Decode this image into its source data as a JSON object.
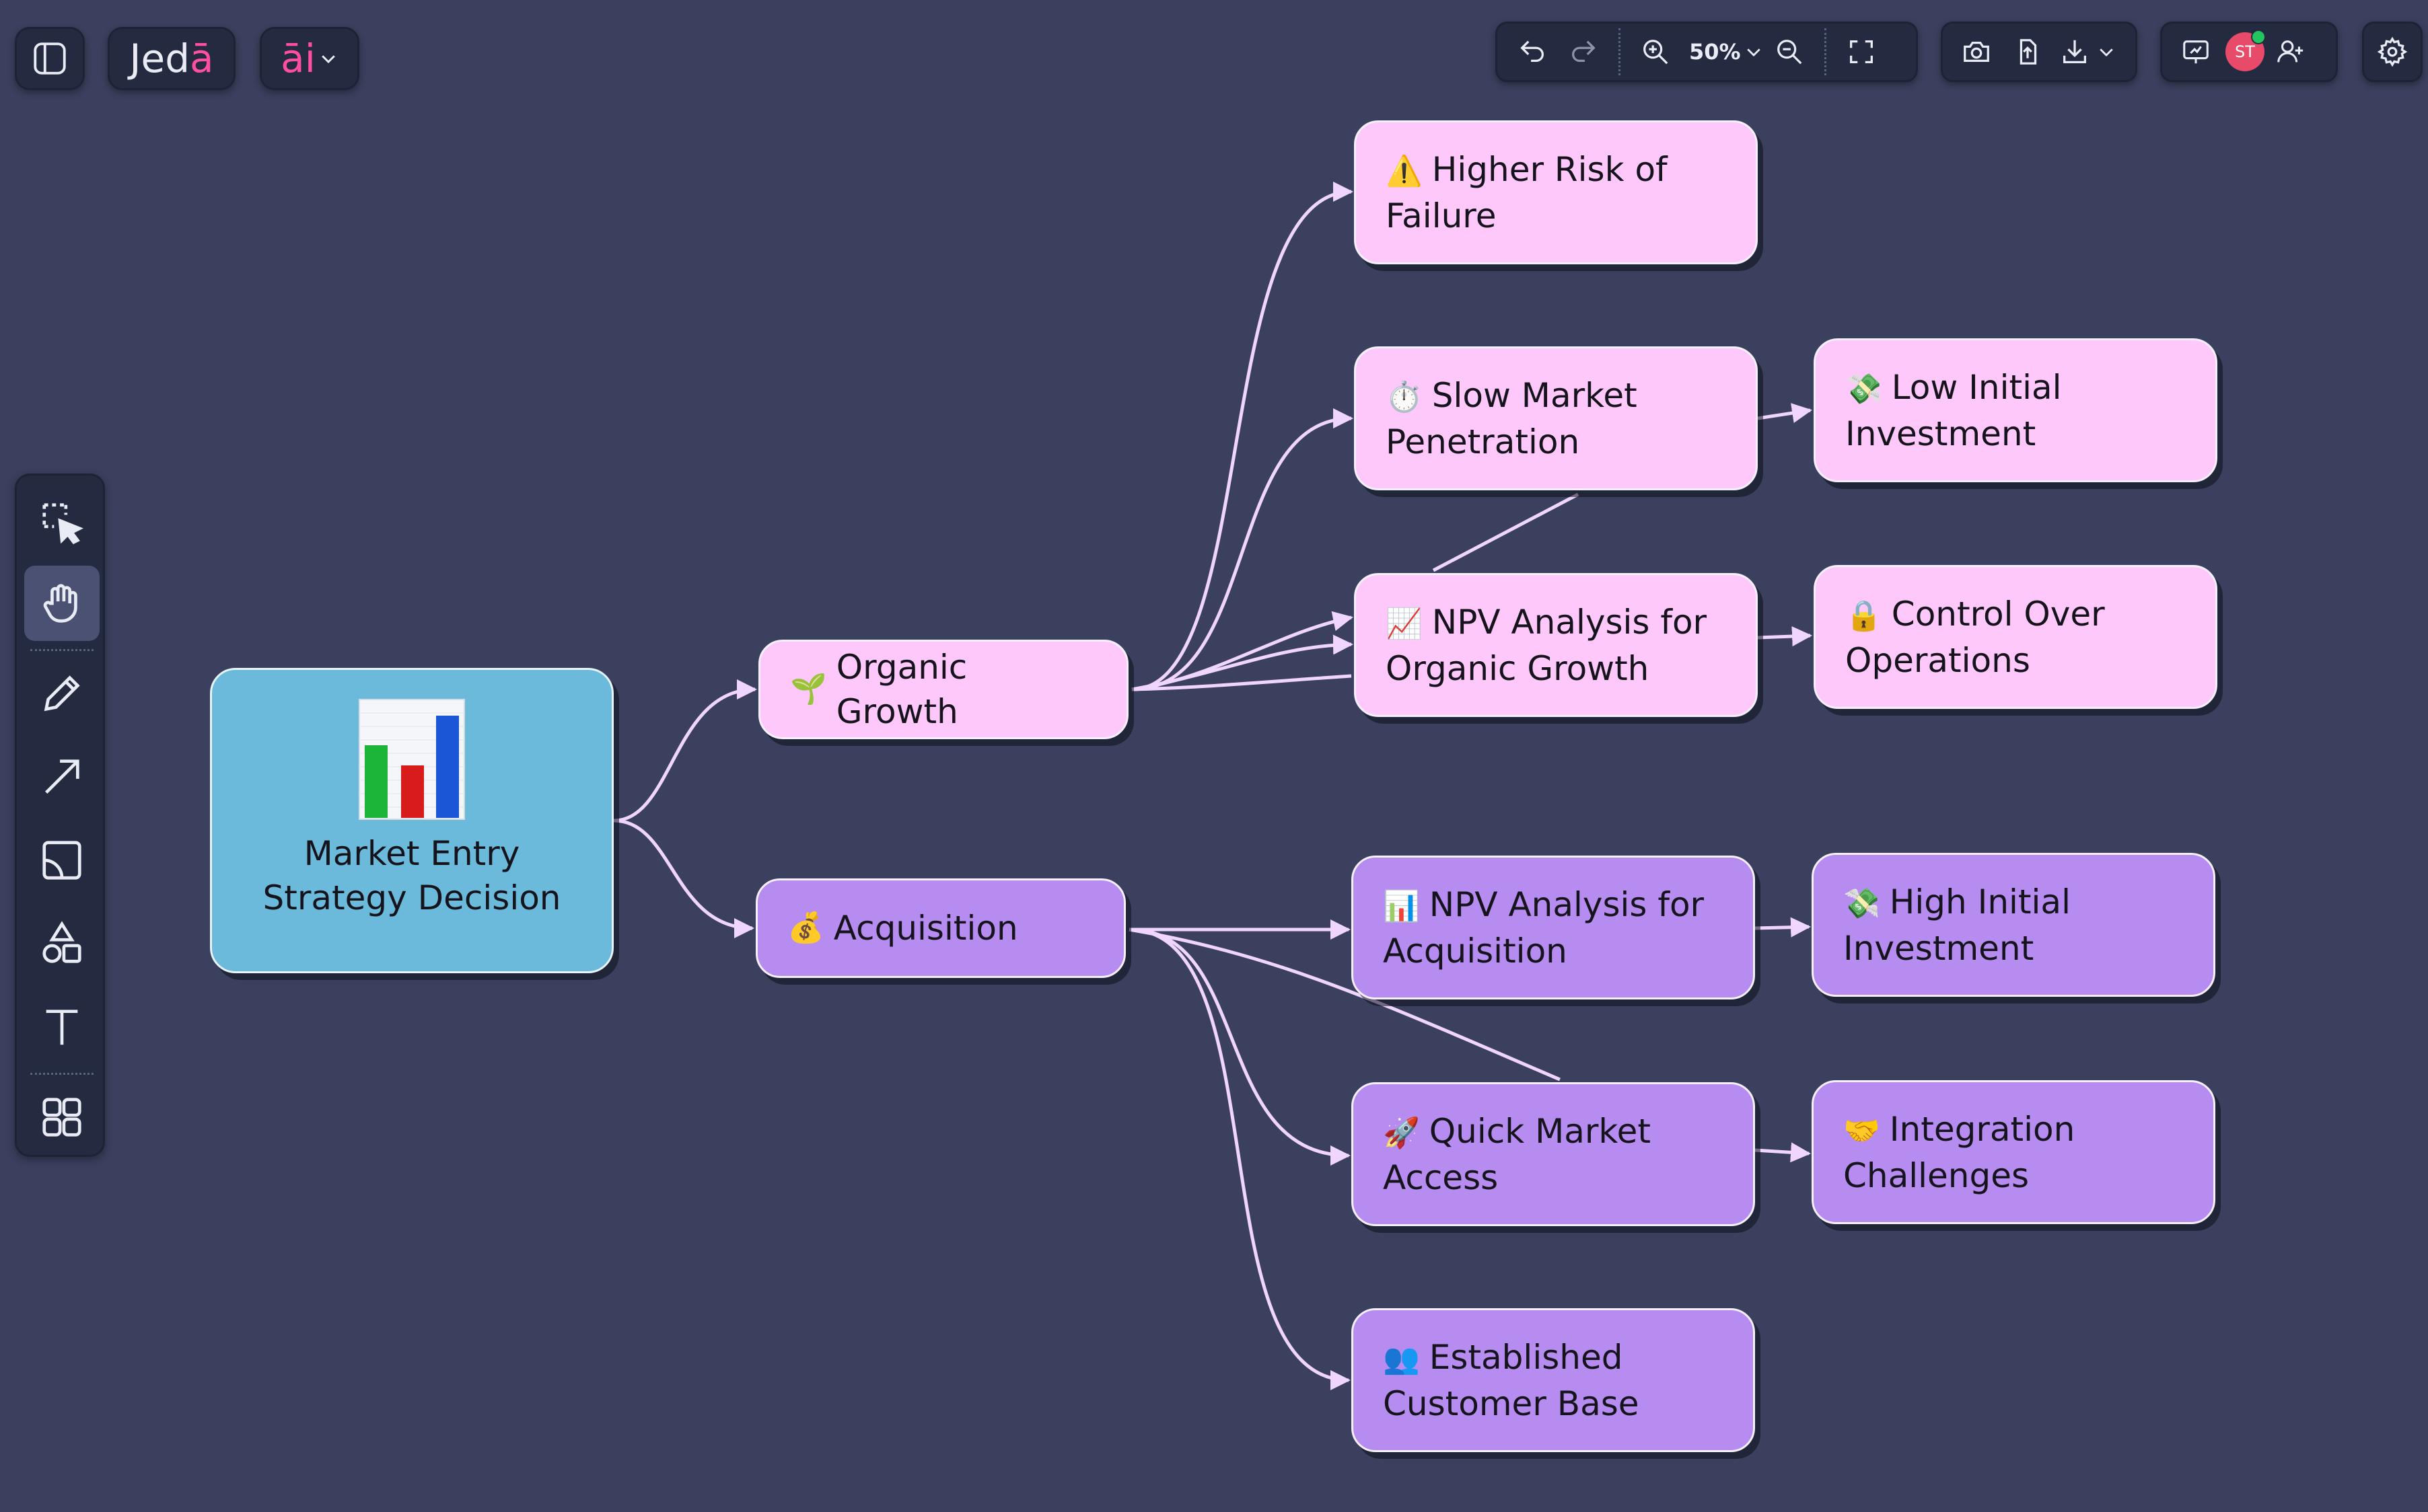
{
  "app": {
    "brand_prefix": "Jed",
    "brand_suffix": "ā",
    "ai_label": "āi"
  },
  "toolbar": {
    "zoom_label": "50%",
    "avatar_initials": "ST"
  },
  "colors": {
    "canvas": "#3a405d",
    "toolbar": "#242a40",
    "root_node": "#6cbadb",
    "branch_pink": "#ffc8fb",
    "branch_purple": "#b68cf0",
    "edge": "#f0d6ff",
    "brand_accent": "#ff4fa3",
    "avatar": "#e84a6a"
  },
  "map": {
    "root": {
      "label": "Market Entry Strategy Decision",
      "icon": "bar-chart-icon"
    },
    "organic": {
      "label": "Organic Growth",
      "icon": "🌱"
    },
    "acquisition": {
      "label": "Acquisition",
      "icon": "💰"
    },
    "higher_risk": {
      "label": "Higher Risk of Failure",
      "icon": "⚠️"
    },
    "slow_market": {
      "label": "Slow Market Penetration",
      "icon": "⏱️"
    },
    "npv_organic": {
      "label": "NPV Analysis for Organic Growth",
      "icon": "📈"
    },
    "low_investment": {
      "label": "Low Initial Investment",
      "icon": "💸"
    },
    "control_ops": {
      "label": "Control Over Operations",
      "icon": "🔒"
    },
    "npv_acq": {
      "label": "NPV Analysis for Acquisition",
      "icon": "📊"
    },
    "high_investment": {
      "label": "High Initial Investment",
      "icon": "💸"
    },
    "quick_access": {
      "label": "Quick Market Access",
      "icon": "🚀"
    },
    "integration": {
      "label": "Integration Challenges",
      "icon": "🤝"
    },
    "customer_base": {
      "label": "Established Customer Base",
      "icon": "👥"
    }
  }
}
